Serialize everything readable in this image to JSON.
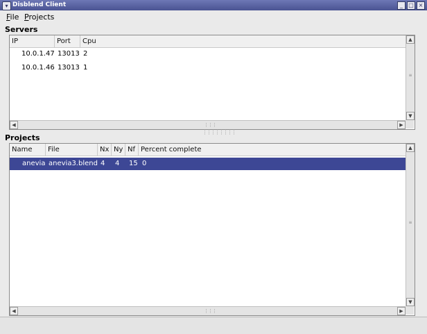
{
  "window": {
    "title": "Disblend Client"
  },
  "menubar": {
    "items": [
      {
        "label": "File"
      },
      {
        "label": "Projects"
      }
    ]
  },
  "servers": {
    "section_label": "Servers",
    "columns": [
      "IP",
      "Port",
      "Cpu"
    ],
    "rows": [
      {
        "ip": "10.0.1.47",
        "port": "13013",
        "cpu": "2"
      },
      {
        "ip": "10.0.1.46",
        "port": "13013",
        "cpu": "1"
      }
    ]
  },
  "projects": {
    "section_label": "Projects",
    "columns": [
      "Name",
      "File",
      "Nx",
      "Ny",
      "Nf",
      "Percent complete"
    ],
    "rows": [
      {
        "name": "anevia",
        "file": "anevia3.blend",
        "nx": "4",
        "ny": "4",
        "nf": "15",
        "percent": "0",
        "selected": true
      }
    ]
  },
  "colors": {
    "titlebar": "#4a5392",
    "selection": "#3d4795"
  }
}
